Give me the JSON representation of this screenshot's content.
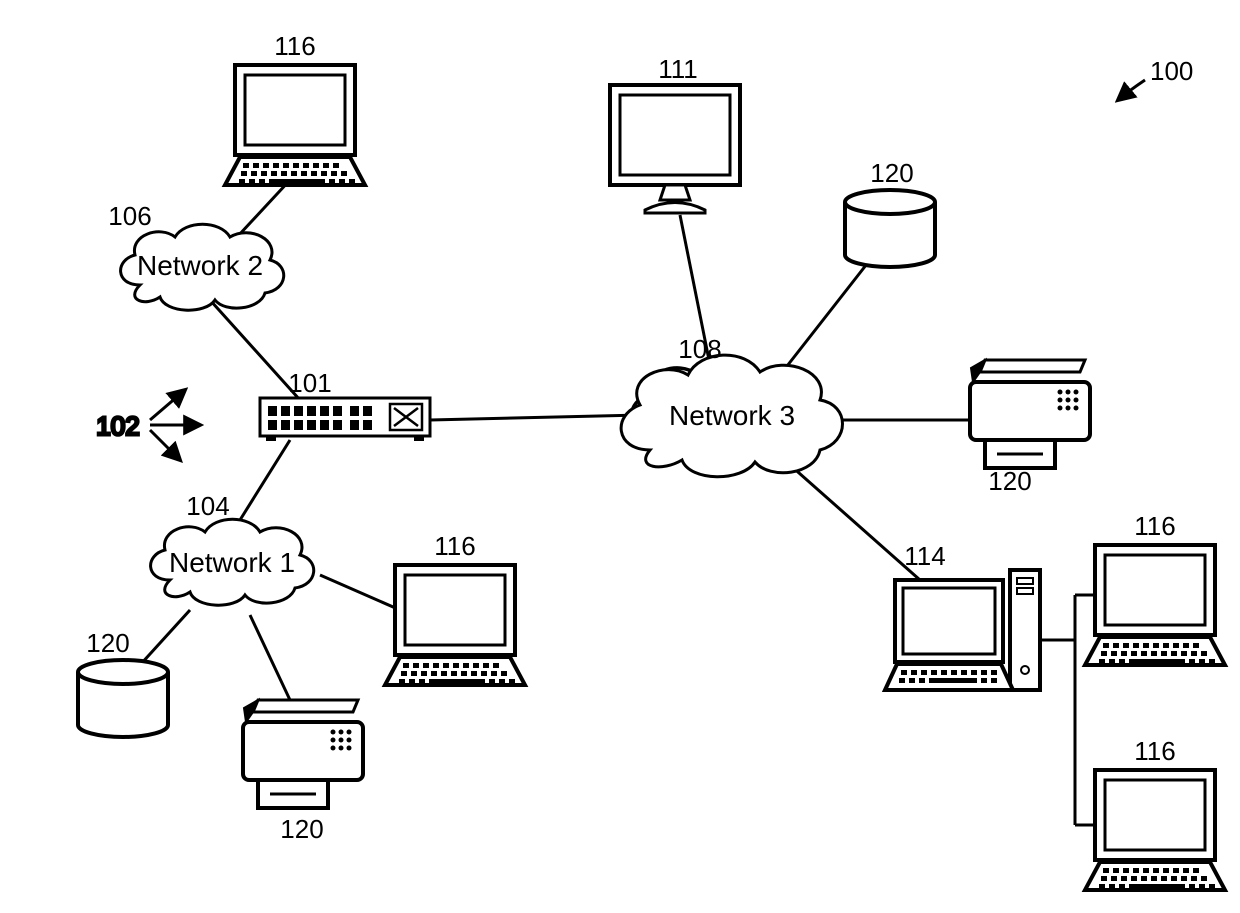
{
  "diagram": {
    "ref_main": "100",
    "ref_arrows": "102",
    "switch": {
      "ref": "101"
    },
    "networks": {
      "n1": {
        "ref": "104",
        "label": "Network 1"
      },
      "n2": {
        "ref": "106",
        "label": "Network 2"
      },
      "n3": {
        "ref": "108",
        "label": "Network 3"
      }
    },
    "devices": {
      "pc_top_left": {
        "ref": "116"
      },
      "pc_net1": {
        "ref": "116"
      },
      "pc_right_a": {
        "ref": "116"
      },
      "pc_right_b": {
        "ref": "116"
      },
      "monitor_top": {
        "ref": "111"
      },
      "server_pc": {
        "ref": "114"
      },
      "db_net1": {
        "ref": "120"
      },
      "db_net3": {
        "ref": "120"
      },
      "printer_net1": {
        "ref": "120"
      },
      "printer_net3": {
        "ref": "120"
      }
    }
  }
}
